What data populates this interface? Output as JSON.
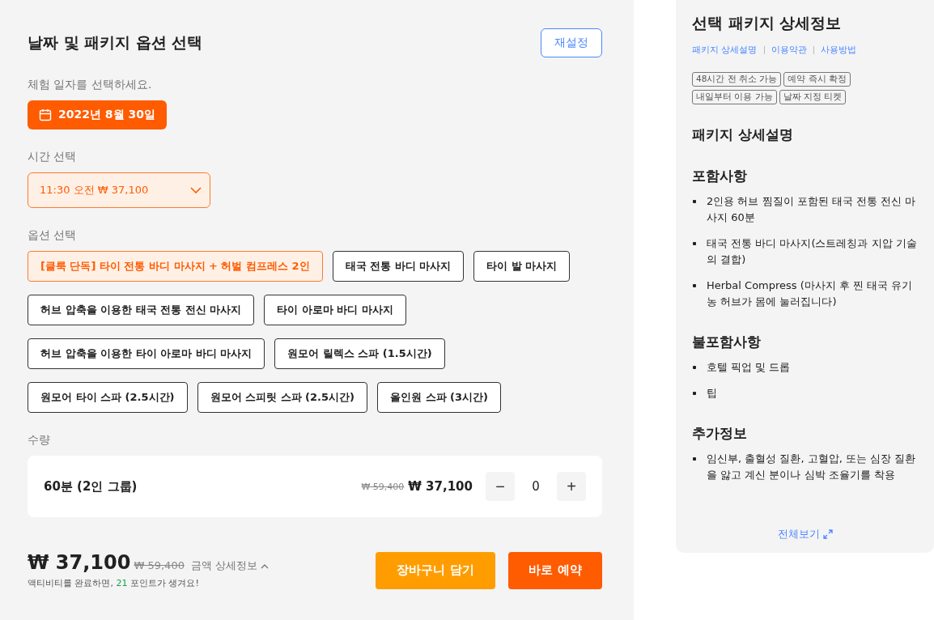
{
  "booking": {
    "title": "날짜 및 패키지 옵션 선택",
    "reset_button": "재설정",
    "date_label": "체험 일자를 선택하세요.",
    "date": "2022년 8월 30일",
    "time_label": "시간 선택",
    "time_value": "11:30 오전 ₩ 37,100",
    "option_label": "옵션 선택",
    "options": [
      {
        "label": "[클룩 단독] 타이 전통 바디 마사지 + 허벌 컴프레스 2인",
        "selected": true
      },
      {
        "label": "태국 전통 바디 마사지",
        "selected": false
      },
      {
        "label": "타이 발 마사지",
        "selected": false
      },
      {
        "label": "허브 압축을 이용한 태국 전통 전신 마사지",
        "selected": false
      },
      {
        "label": "타이 아로마 바디 마사지",
        "selected": false
      },
      {
        "label": "허브 압축을 이용한 타이 아로마 바디 마사지",
        "selected": false
      },
      {
        "label": "원모어 릴렉스 스파 (1.5시간)",
        "selected": false
      },
      {
        "label": "원모어 타이 스파 (2.5시간)",
        "selected": false
      },
      {
        "label": "원모어 스피릿 스파 (2.5시간)",
        "selected": false
      },
      {
        "label": "올인원 스파 (3시간)",
        "selected": false
      }
    ],
    "quantity_label": "수량",
    "quantity_row": {
      "name": "60분 (2인 그룹)",
      "old_price": "₩ 59,400",
      "price": "₩ 37,100",
      "minus": "−",
      "count": "0",
      "plus": "+"
    },
    "total": {
      "price": "₩ 37,100",
      "old_price": "₩ 59,400",
      "details_link": "금액 상세정보",
      "note_before": "액티비티를 완료하면, ",
      "note_points": "21",
      "note_after": " 포인트가 생겨요!"
    },
    "cart_button": "장바구니 담기",
    "book_button": "바로 예약"
  },
  "details": {
    "title": "선택 패키지 상세정보",
    "links": [
      "패키지 상세설명",
      "이용약관",
      "사용방법"
    ],
    "tags": [
      "48시간 전 취소 가능",
      "예약 즉시 확정",
      "내일부터 이용 가능",
      "날짜 지정 티켓"
    ],
    "heading": "패키지 상세설명",
    "sections": [
      {
        "title": "포함사항",
        "items": [
          "2인용 허브 찜질이 포함된 태국 전통 전신 마사지 60분",
          "태국 전통 바디 마사지(스트레칭과 지압 기술의 결합)",
          "Herbal Compress (마사지 후 찐 태국 유기농 허브가 몸에 눌러집니다)"
        ]
      },
      {
        "title": "불포함사항",
        "items": [
          "호텔 픽업 및 드롭",
          "팁"
        ]
      },
      {
        "title": "추가정보",
        "items": [
          "임신부, 출혈성 질환, 고혈압, 또는 심장 질환을 앓고 계신 분이나 심박 조율기를 착용"
        ]
      }
    ],
    "view_all": "전체보기"
  }
}
